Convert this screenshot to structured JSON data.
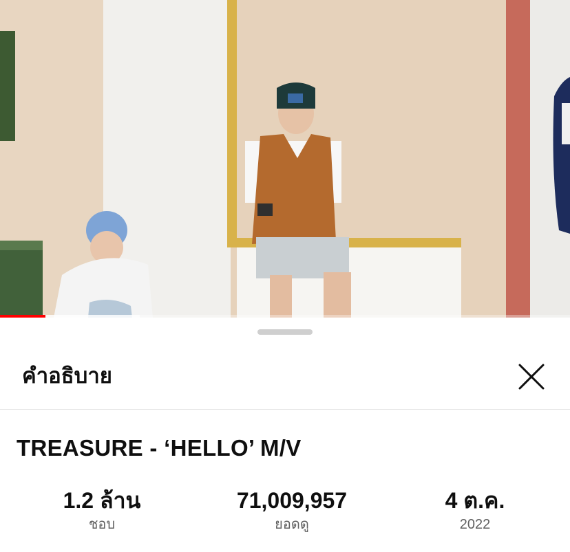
{
  "player": {
    "progress_played_fraction": 0.08,
    "progress_buffered_fraction": 0.245,
    "accent_color": "#ff0000"
  },
  "sheet": {
    "title": "คำอธิบาย",
    "close_icon": "close-icon"
  },
  "video": {
    "title": "TREASURE - ‘HELLO’ M/V"
  },
  "stats": [
    {
      "value": "1.2 ล้าน",
      "label": "ชอบ"
    },
    {
      "value": "71,009,957",
      "label": "ยอดดู"
    },
    {
      "value": "4 ต.ค.",
      "label": "2022"
    }
  ]
}
